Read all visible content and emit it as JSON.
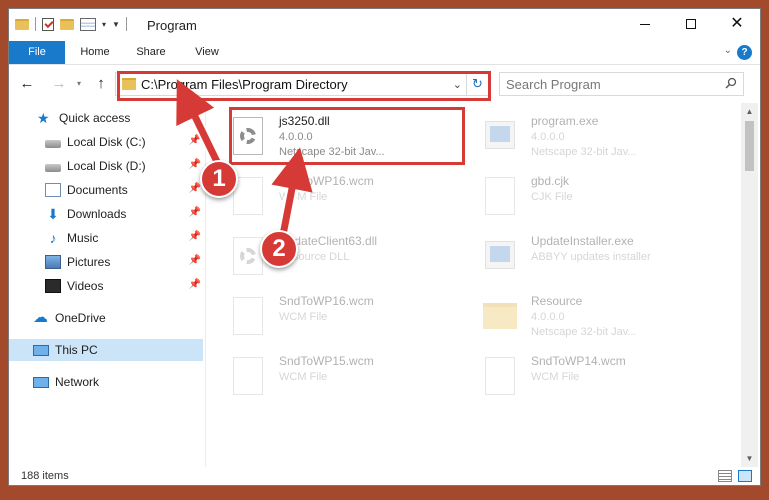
{
  "window": {
    "title": "Program",
    "minimize_icon": "minimize-icon",
    "maximize_icon": "maximize-icon",
    "close_icon": "close-icon"
  },
  "ribbon": {
    "tabs": [
      "File",
      "Home",
      "Share",
      "View"
    ],
    "accent": "#1979ca"
  },
  "address": {
    "path": "C:\\Program Files\\Program Directory"
  },
  "search": {
    "placeholder": "Search Program"
  },
  "sidebar": {
    "items": [
      {
        "label": "Quick access",
        "icon": "star-icon",
        "pinned": false
      },
      {
        "label": "Local Disk (C:)",
        "icon": "disk-icon",
        "pinned": true
      },
      {
        "label": "Local Disk (D:)",
        "icon": "disk-icon",
        "pinned": true
      },
      {
        "label": "Documents",
        "icon": "documents-icon",
        "pinned": true
      },
      {
        "label": "Downloads",
        "icon": "download-icon",
        "pinned": true
      },
      {
        "label": "Music",
        "icon": "music-icon",
        "pinned": true
      },
      {
        "label": "Pictures",
        "icon": "pictures-icon",
        "pinned": true
      },
      {
        "label": "Videos",
        "icon": "videos-icon",
        "pinned": true
      },
      {
        "label": "OneDrive",
        "icon": "onedrive-icon",
        "pinned": false
      },
      {
        "label": "This PC",
        "icon": "this-pc-icon",
        "pinned": false,
        "selected": true
      },
      {
        "label": "Network",
        "icon": "network-icon",
        "pinned": false
      }
    ]
  },
  "files": [
    {
      "name": "js3250.dll",
      "line2": "4.0.0.0",
      "line3": "Netscape 32-bit Jav...",
      "icon": "dll-gear-icon",
      "highlighted": true
    },
    {
      "name": "program.exe",
      "line2": "4.0.0.0",
      "line3": "Netscape 32-bit Jav...",
      "icon": "exe-icon"
    },
    {
      "name": "SndToWP16.wcm",
      "line2": "WCM File",
      "line3": "",
      "icon": "document-icon"
    },
    {
      "name": "gbd.cjk",
      "line2": "CJK File",
      "line3": "",
      "icon": "document-icon"
    },
    {
      "name": "UpdateClient63.dll",
      "line2": "Resource DLL",
      "line3": "",
      "icon": "dll-gear-icon"
    },
    {
      "name": "UpdateInstaller.exe",
      "line2": "ABBYY updates installer",
      "line3": "",
      "icon": "exe-icon"
    },
    {
      "name": "SndToWP16.wcm",
      "line2": "WCM File",
      "line3": "",
      "icon": "document-icon"
    },
    {
      "name": "Resource",
      "line2": "4.0.0.0",
      "line3": "Netscape 32-bit Jav...",
      "icon": "folder-icon"
    },
    {
      "name": "SndToWP15.wcm",
      "line2": "WCM File",
      "line3": "",
      "icon": "document-icon"
    },
    {
      "name": "SndToWP14.wcm",
      "line2": "WCM File",
      "line3": "",
      "icon": "document-icon"
    }
  ],
  "status": {
    "items_count": "188 items"
  },
  "annotations": {
    "callout_1": "1",
    "callout_2": "2",
    "highlight_color": "#d63a36"
  }
}
